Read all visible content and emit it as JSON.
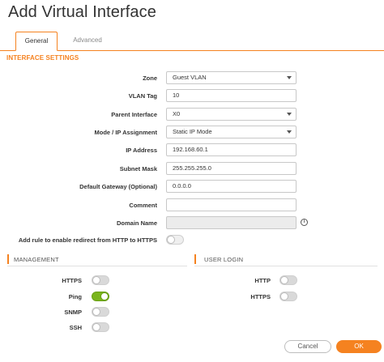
{
  "dialog": {
    "title": "Add Virtual Interface"
  },
  "tabs": [
    {
      "label": "General",
      "active": true
    },
    {
      "label": "Advanced",
      "active": false
    }
  ],
  "section": {
    "title": "INTERFACE SETTINGS"
  },
  "form": {
    "zone": {
      "label": "Zone",
      "value": "Guest VLAN"
    },
    "vlan_tag": {
      "label": "VLAN Tag",
      "value": "10"
    },
    "parent_interface": {
      "label": "Parent Interface",
      "value": "X0"
    },
    "mode": {
      "label": "Mode / IP Assignment",
      "value": "Static IP Mode"
    },
    "ip_address": {
      "label": "IP Address",
      "value": "192.168.60.1"
    },
    "subnet_mask": {
      "label": "Subnet Mask",
      "value": "255.255.255.0"
    },
    "default_gateway": {
      "label": "Default Gateway (Optional)",
      "value": "0.0.0.0"
    },
    "comment": {
      "label": "Comment",
      "value": ""
    },
    "domain_name": {
      "label": "Domain Name",
      "value": ""
    },
    "redirect_rule": {
      "label": "Add rule to enable redirect from HTTP to HTTPS",
      "on": false
    }
  },
  "management": {
    "title": "MANAGEMENT",
    "items": [
      {
        "label": "HTTPS",
        "on": false
      },
      {
        "label": "Ping",
        "on": true
      },
      {
        "label": "SNMP",
        "on": false
      },
      {
        "label": "SSH",
        "on": false
      }
    ]
  },
  "user_login": {
    "title": "USER LOGIN",
    "items": [
      {
        "label": "HTTP",
        "on": false
      },
      {
        "label": "HTTPS",
        "on": false
      }
    ]
  },
  "buttons": {
    "cancel": "Cancel",
    "ok": "OK"
  },
  "icons": {
    "info": "info-icon",
    "dropdown": "chevron-down-icon"
  },
  "colors": {
    "accent": "#f58220",
    "toggle_on": "#7ab51d",
    "toggle_off": "#d9d9d9"
  },
  "glyphs": {
    "info": "i"
  }
}
